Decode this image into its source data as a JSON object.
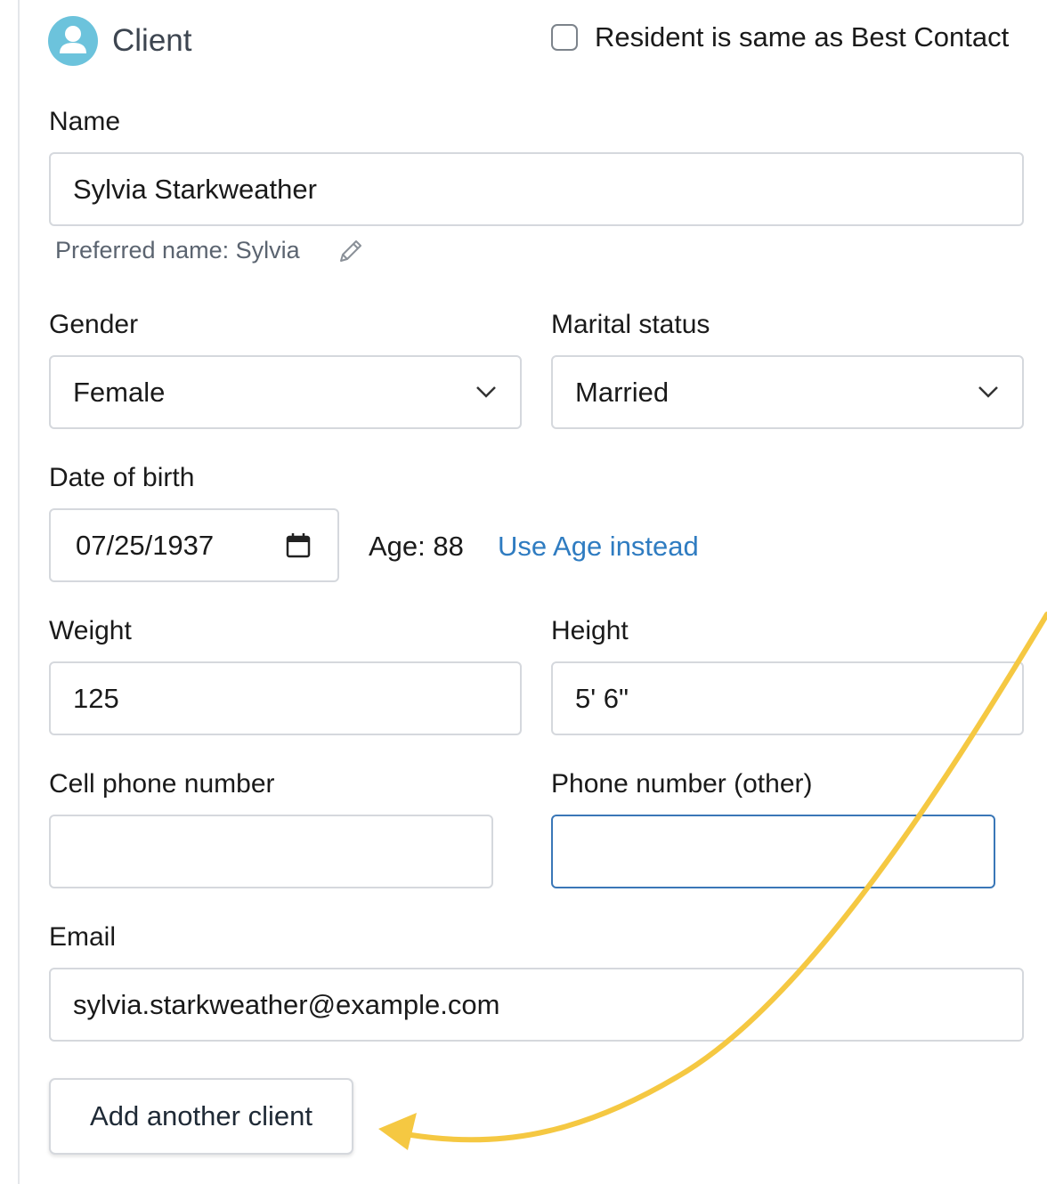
{
  "header": {
    "title": "Client",
    "avatar_icon": "user-avatar-icon",
    "resident_same_label": "Resident is same as Best Contact",
    "resident_same_checked": false
  },
  "name": {
    "label": "Name",
    "value": "Sylvia Starkweather",
    "preferred_name": "Preferred name: Sylvia",
    "edit_icon": "pencil-icon"
  },
  "gender": {
    "label": "Gender",
    "value": "Female"
  },
  "marital_status": {
    "label": "Marital status",
    "value": "Married"
  },
  "dob": {
    "label": "Date of birth",
    "value": "07/25/1937",
    "age_text": "Age: 88",
    "use_age_link": "Use Age instead"
  },
  "weight": {
    "label": "Weight",
    "value": "125"
  },
  "height": {
    "label": "Height",
    "value": "5' 6\""
  },
  "cell_phone": {
    "label": "Cell phone number",
    "value": ""
  },
  "other_phone": {
    "label": "Phone number (other)",
    "value": ""
  },
  "email": {
    "label": "Email",
    "value": "sylvia.starkweather@example.com"
  },
  "add_client_label": "Add another client",
  "colors": {
    "accent_link": "#2f7cc1",
    "avatar_bg": "#6cc3dc",
    "annotation_arrow": "#f5c842",
    "focus_border": "#3a77b7"
  }
}
